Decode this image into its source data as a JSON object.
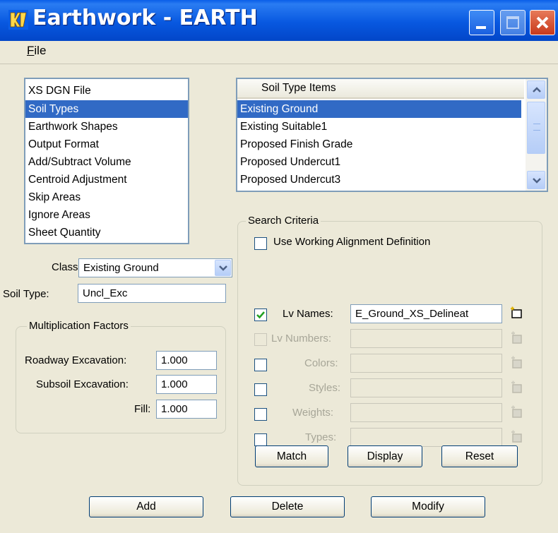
{
  "window": {
    "title": "Earthwork - EARTH",
    "menu": [
      "File"
    ]
  },
  "category_list": {
    "items": [
      "XS DGN File",
      "Soil Types",
      "Earthwork Shapes",
      "Output Format",
      "Add/Subtract Volume",
      "Centroid Adjustment",
      "Skip Areas",
      "Ignore Areas",
      "Sheet Quantity"
    ],
    "selected": "Soil Types"
  },
  "soil_items": {
    "header": "Soil Type Items",
    "items": [
      "Existing Ground",
      "Existing Suitable1",
      "Proposed Finish Grade",
      "Proposed Undercut1",
      "Proposed Undercut3"
    ],
    "selected": "Existing Ground"
  },
  "class_field": {
    "label": "Class",
    "value": "Existing Ground"
  },
  "soil_type_field": {
    "label": "Soil Type:",
    "value": "Uncl_Exc"
  },
  "multiplication": {
    "title": "Multiplication Factors",
    "roadway_label": "Roadway Excavation:",
    "roadway_value": "1.000",
    "subsoil_label": "Subsoil Excavation:",
    "subsoil_value": "1.000",
    "fill_label": "Fill:",
    "fill_value": "1.000"
  },
  "search": {
    "title": "Search Criteria",
    "use_working_label": "Use Working Alignment Definition",
    "use_working_checked": false,
    "lv_names_label": "Lv Names:",
    "lv_names_value": "E_Ground_XS_Delineat",
    "lv_names_checked": true,
    "lv_numbers_label": "Lv Numbers:",
    "colors_label": "Colors:",
    "styles_label": "Styles:",
    "weights_label": "Weights:",
    "types_label": "Types:",
    "match_label": "Match",
    "display_label": "Display",
    "reset_label": "Reset"
  },
  "footer": {
    "add_label": "Add",
    "delete_label": "Delete",
    "modify_label": "Modify"
  },
  "colors": {
    "titlebar": "#0a5ee8",
    "selection": "#316ac5",
    "dialog": "#ece9d8",
    "close": "#c8391c"
  }
}
